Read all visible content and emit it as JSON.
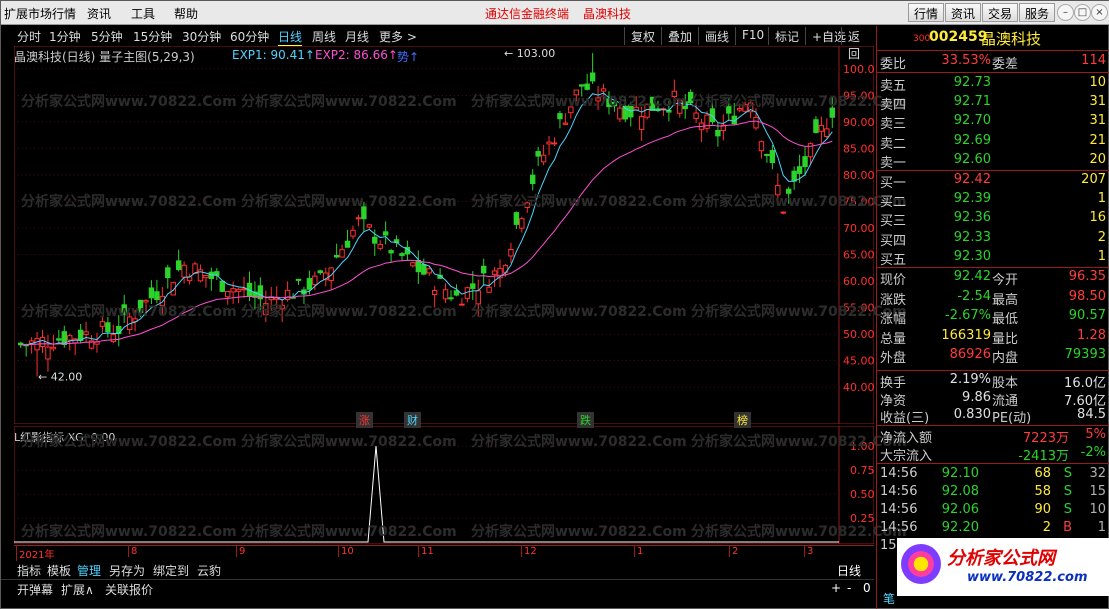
{
  "menu": {
    "items": [
      "扩展市场行情",
      "资讯",
      "工具",
      "帮助"
    ],
    "promo": "通达信金融终端",
    "stock_promo": "晶澳科技",
    "right_buttons": [
      "行情",
      "资讯",
      "交易",
      "服务"
    ]
  },
  "periods": [
    "分时",
    "1分钟",
    "5分钟",
    "15分钟",
    "30分钟",
    "60分钟",
    "日线",
    "周线",
    "月线",
    "更多 >"
  ],
  "active_period": "日线",
  "toolbar": [
    "复权",
    "叠加",
    "画线",
    "F10",
    "标记",
    "+自选",
    "返回"
  ],
  "chart": {
    "title": "晶澳科技(日线) 量子主图(5,29,3)",
    "exp1": "EXP1: 90.41↑",
    "exp2": "EXP2: 86.66↑",
    "exp3": "势↑",
    "high_label": "103.00",
    "low_label": "42.00",
    "events": [
      "涨",
      "财",
      "跌",
      "榜"
    ],
    "sub_title": "L红影指标  XG: 0.00",
    "colors": {
      "up": "#ff3030",
      "down": "#2bd32b",
      "exp1": "#4fd3ff",
      "exp2": "#ff4fd3"
    }
  },
  "chart_data": {
    "type": "candlestick",
    "title": "晶澳科技(日线)",
    "y_ticks": [
      40,
      45,
      50,
      55,
      60,
      65,
      70,
      75,
      80,
      85,
      90,
      95,
      100
    ],
    "sub_y_ticks": [
      "1.00",
      "0.75",
      "0.50",
      "0.25"
    ],
    "x_labels": [
      "2021年",
      "8",
      "9",
      "10",
      "11",
      "12",
      "1",
      "2",
      "3"
    ],
    "range_y": [
      42.0,
      103.0
    ],
    "last_close": 92.42
  },
  "watermark": "分析家公式网www.70822.Com",
  "tabs1": [
    "指标",
    "模板",
    "管理",
    "另存为",
    "绑定到",
    "云豹"
  ],
  "tabs2": [
    "开弹幕",
    "扩展∧",
    "关联报价"
  ],
  "right": {
    "code_prefix": "300",
    "code": "002459",
    "name": "晶澳科技",
    "weibi": {
      "label": "委比",
      "value": "33.53%",
      "label2": "委差",
      "value2": "114"
    },
    "asks": [
      {
        "l": "卖五",
        "p": "92.73",
        "q": "10"
      },
      {
        "l": "卖四",
        "p": "92.71",
        "q": "31"
      },
      {
        "l": "卖三",
        "p": "92.70",
        "q": "31"
      },
      {
        "l": "卖二",
        "p": "92.69",
        "q": "21"
      },
      {
        "l": "卖一",
        "p": "92.60",
        "q": "20"
      }
    ],
    "bids": [
      {
        "l": "买一",
        "p": "92.42",
        "q": "207"
      },
      {
        "l": "买二",
        "p": "92.39",
        "q": "1"
      },
      {
        "l": "买三",
        "p": "92.36",
        "q": "16"
      },
      {
        "l": "买四",
        "p": "92.33",
        "q": "2"
      },
      {
        "l": "买五",
        "p": "92.30",
        "q": "1"
      }
    ],
    "quote": [
      {
        "l": "现价",
        "v": "92.42",
        "l2": "今开",
        "v2": "96.35"
      },
      {
        "l": "涨跌",
        "v": "-2.54",
        "l2": "最高",
        "v2": "98.50"
      },
      {
        "l": "涨幅",
        "v": "-2.67%",
        "l2": "最低",
        "v2": "90.57"
      },
      {
        "l": "总量",
        "v": "166319",
        "l2": "量比",
        "v2": "1.28"
      },
      {
        "l": "外盘",
        "v": "86926",
        "l2": "内盘",
        "v2": "79393"
      }
    ],
    "stats": [
      {
        "l": "换手",
        "v": "2.19%",
        "l2": "股本",
        "v2": "16.0亿"
      },
      {
        "l": "净资",
        "v": "9.86",
        "l2": "流通",
        "v2": "7.60亿"
      },
      {
        "l": "收益(三)",
        "v": "0.830",
        "l2": "PE(动)",
        "v2": "84.5"
      }
    ],
    "flow": [
      {
        "l": "净流入额",
        "v": "7223万",
        "p": "5%"
      },
      {
        "l": "大宗流入",
        "v": "-2413万",
        "p": "-2%"
      }
    ],
    "ticks": [
      {
        "t": "14:56",
        "p": "92.10",
        "q": "68",
        "s": "S",
        "n": "32"
      },
      {
        "t": "14:56",
        "p": "92.08",
        "q": "58",
        "s": "S",
        "n": "15"
      },
      {
        "t": "14:56",
        "p": "92.06",
        "q": "90",
        "s": "S",
        "n": "10"
      },
      {
        "t": "14:56",
        "p": "92.20",
        "q": "2",
        "s": "B",
        "n": "1"
      },
      {
        "t": "15:",
        "p": "",
        "q": "",
        "s": "",
        "n": ""
      }
    ],
    "logo": "分析家公式网",
    "logo_url": "www.70822.com",
    "bottom_label": "日线",
    "bottom_tab": "笔"
  }
}
